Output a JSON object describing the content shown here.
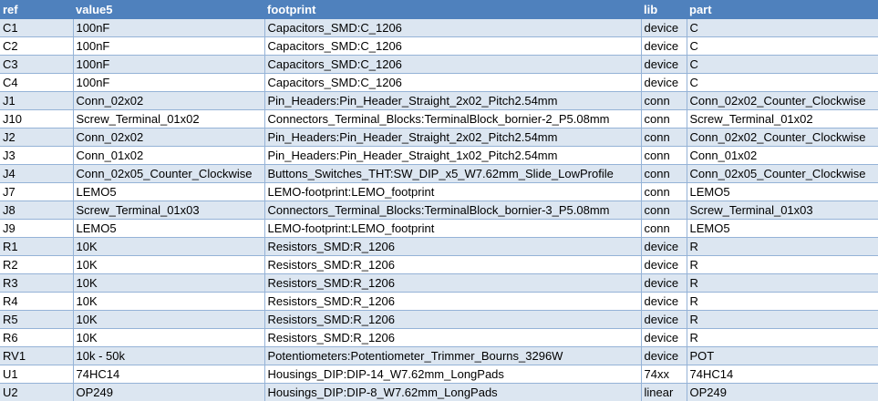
{
  "table": {
    "headers": [
      "ref",
      "value5",
      "footprint",
      "lib",
      "part"
    ],
    "rows": [
      [
        "C1",
        "100nF",
        "Capacitors_SMD:C_1206",
        "device",
        "C"
      ],
      [
        "C2",
        "100nF",
        "Capacitors_SMD:C_1206",
        "device",
        "C"
      ],
      [
        "C3",
        "100nF",
        "Capacitors_SMD:C_1206",
        "device",
        "C"
      ],
      [
        "C4",
        "100nF",
        "Capacitors_SMD:C_1206",
        "device",
        "C"
      ],
      [
        "J1",
        "Conn_02x02",
        "Pin_Headers:Pin_Header_Straight_2x02_Pitch2.54mm",
        "conn",
        "Conn_02x02_Counter_Clockwise"
      ],
      [
        "J10",
        "Screw_Terminal_01x02",
        "Connectors_Terminal_Blocks:TerminalBlock_bornier-2_P5.08mm",
        "conn",
        "Screw_Terminal_01x02"
      ],
      [
        "J2",
        "Conn_02x02",
        "Pin_Headers:Pin_Header_Straight_2x02_Pitch2.54mm",
        "conn",
        "Conn_02x02_Counter_Clockwise"
      ],
      [
        "J3",
        "Conn_01x02",
        "Pin_Headers:Pin_Header_Straight_1x02_Pitch2.54mm",
        "conn",
        "Conn_01x02"
      ],
      [
        "J4",
        "Conn_02x05_Counter_Clockwise",
        "Buttons_Switches_THT:SW_DIP_x5_W7.62mm_Slide_LowProfile",
        "conn",
        "Conn_02x05_Counter_Clockwise"
      ],
      [
        "J7",
        "LEMO5",
        "LEMO-footprint:LEMO_footprint",
        "conn",
        "LEMO5"
      ],
      [
        "J8",
        "Screw_Terminal_01x03",
        "Connectors_Terminal_Blocks:TerminalBlock_bornier-3_P5.08mm",
        "conn",
        "Screw_Terminal_01x03"
      ],
      [
        "J9",
        "LEMO5",
        "LEMO-footprint:LEMO_footprint",
        "conn",
        "LEMO5"
      ],
      [
        "R1",
        "10K",
        "Resistors_SMD:R_1206",
        "device",
        "R"
      ],
      [
        "R2",
        "10K",
        "Resistors_SMD:R_1206",
        "device",
        "R"
      ],
      [
        "R3",
        "10K",
        "Resistors_SMD:R_1206",
        "device",
        "R"
      ],
      [
        "R4",
        "10K",
        "Resistors_SMD:R_1206",
        "device",
        "R"
      ],
      [
        "R5",
        "10K",
        "Resistors_SMD:R_1206",
        "device",
        "R"
      ],
      [
        "R6",
        "10K",
        "Resistors_SMD:R_1206",
        "device",
        "R"
      ],
      [
        "RV1",
        "10k - 50k",
        "Potentiometers:Potentiometer_Trimmer_Bourns_3296W",
        "device",
        "POT"
      ],
      [
        "U1",
        "74HC14",
        "Housings_DIP:DIP-14_W7.62mm_LongPads",
        "74xx",
        "74HC14"
      ],
      [
        "U2",
        "OP249",
        "Housings_DIP:DIP-8_W7.62mm_LongPads",
        "linear",
        "OP249"
      ]
    ]
  }
}
